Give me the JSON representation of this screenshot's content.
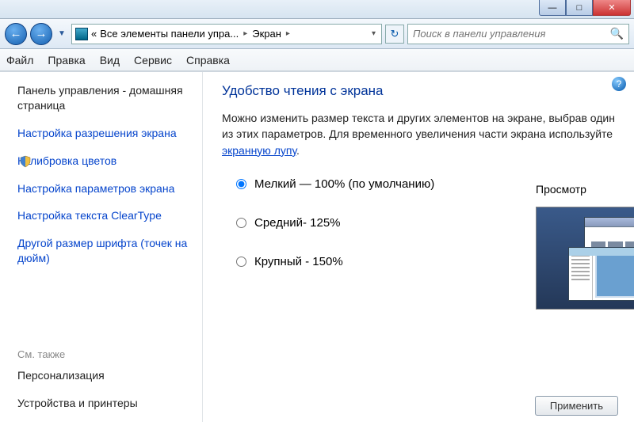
{
  "titlebar": {
    "min": "—",
    "max": "□",
    "close": "✕"
  },
  "nav": {
    "back": "←",
    "forward": "→",
    "dropdown": "▼",
    "chevrons": "«",
    "crumb1": "Все элементы панели упра...",
    "crumb2": "Экран",
    "sep": "▸",
    "dd": "▾",
    "refresh": "↻",
    "search_placeholder": "Поиск в панели управления",
    "search_icon": "🔍"
  },
  "menu": {
    "file": "Файл",
    "edit": "Правка",
    "view": "Вид",
    "service": "Сервис",
    "help": "Справка"
  },
  "sidebar": {
    "home": "Панель управления - домашняя страница",
    "items": [
      "Настройка разрешения экрана",
      "Калибровка цветов",
      "Настройка параметров экрана",
      "Настройка текста ClearType",
      "Другой размер шрифта (точек на дюйм)"
    ],
    "seealso": "См. также",
    "personalization": "Персонализация",
    "devices": "Устройства и принтеры"
  },
  "main": {
    "heading": "Удобство чтения с экрана",
    "desc1": "Можно изменить размер текста и других элементов на экране, выбрав один из этих параметров. Для временного увеличения части экрана используйте ",
    "link": "экранную лупу",
    "dot": ".",
    "opt_small": "Мелкий — 100% (по умолчанию)",
    "opt_medium": "Средний- 125%",
    "opt_large": "Крупный - 150%",
    "preview": "Просмотр",
    "apply": "Применить",
    "help": "?"
  }
}
